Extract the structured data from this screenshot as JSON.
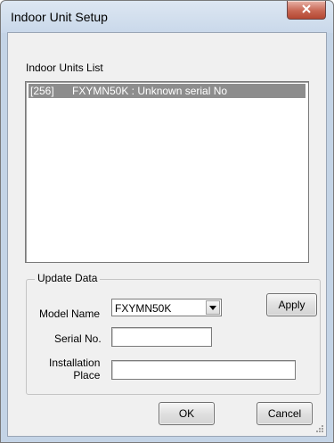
{
  "window": {
    "title": "Indoor Unit Setup"
  },
  "units_list": {
    "label": "Indoor Units List",
    "items": [
      {
        "id": "[256]",
        "description": "FXYMN50K : Unknown serial No",
        "selected": true
      }
    ]
  },
  "update_data": {
    "group_label": "Update Data",
    "model_name_label": "Model Name",
    "model_name_value": "FXYMN50K",
    "apply_label": "Apply",
    "serial_label": "Serial No.",
    "serial_value": "",
    "installation_label_line1": "Installation",
    "installation_label_line2": "Place",
    "installation_value": ""
  },
  "buttons": {
    "ok_label": "OK",
    "cancel_label": "Cancel"
  },
  "colors": {
    "selection": "#8d8d8d",
    "close_button": "#c86754"
  }
}
